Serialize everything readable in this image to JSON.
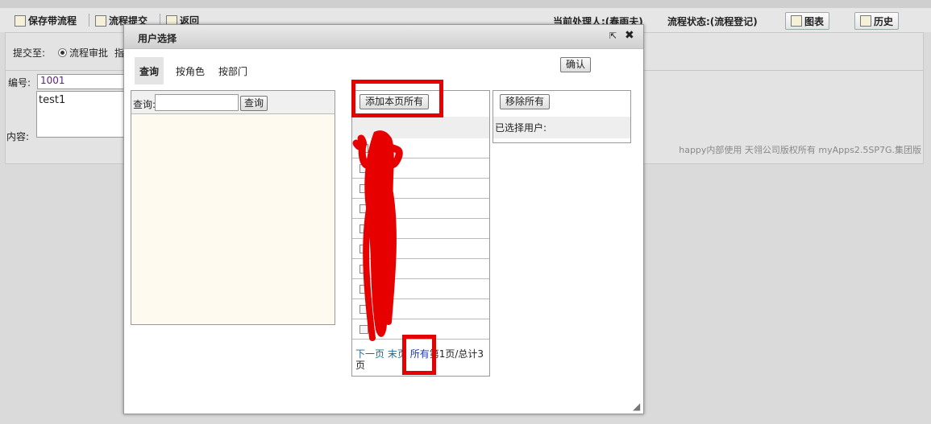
{
  "toolbar": {
    "save_label": "保存带流程",
    "submit_label": "流程提交",
    "back_label": "返回",
    "handler_label": "当前处理人:(春雨夫)",
    "status_label": "流程状态:(流程登记)",
    "chart_label": "图表",
    "history_label": "历史"
  },
  "form": {
    "submit_to_label": "提交至:",
    "radio_label": "流程审批",
    "radio_extra": "指",
    "id_label": "编号:",
    "id_value": "1001",
    "content_label": "内容:",
    "content_value": "test1"
  },
  "footer": {
    "text": "happy内部使用 天翎公司版权所有 myApps2.5SP7G.集团版"
  },
  "dialog": {
    "title": "用户选择",
    "tabs": [
      "查询",
      "按角色",
      "按部门"
    ],
    "confirm_label": "确认",
    "query_label": "查询:",
    "query_value": "",
    "query_button": "查询",
    "add_all_label": "添加本页所有",
    "remove_all_label": "移除所有",
    "selected_label": "已选择用户:",
    "pager": {
      "next": "下一页",
      "last": "末页",
      "all": "所有",
      "info": "第1页/总计3页"
    }
  },
  "colors": {
    "highlight": "#e60000",
    "link": "#1a6a90",
    "tab_active": "#e4e4e4"
  }
}
